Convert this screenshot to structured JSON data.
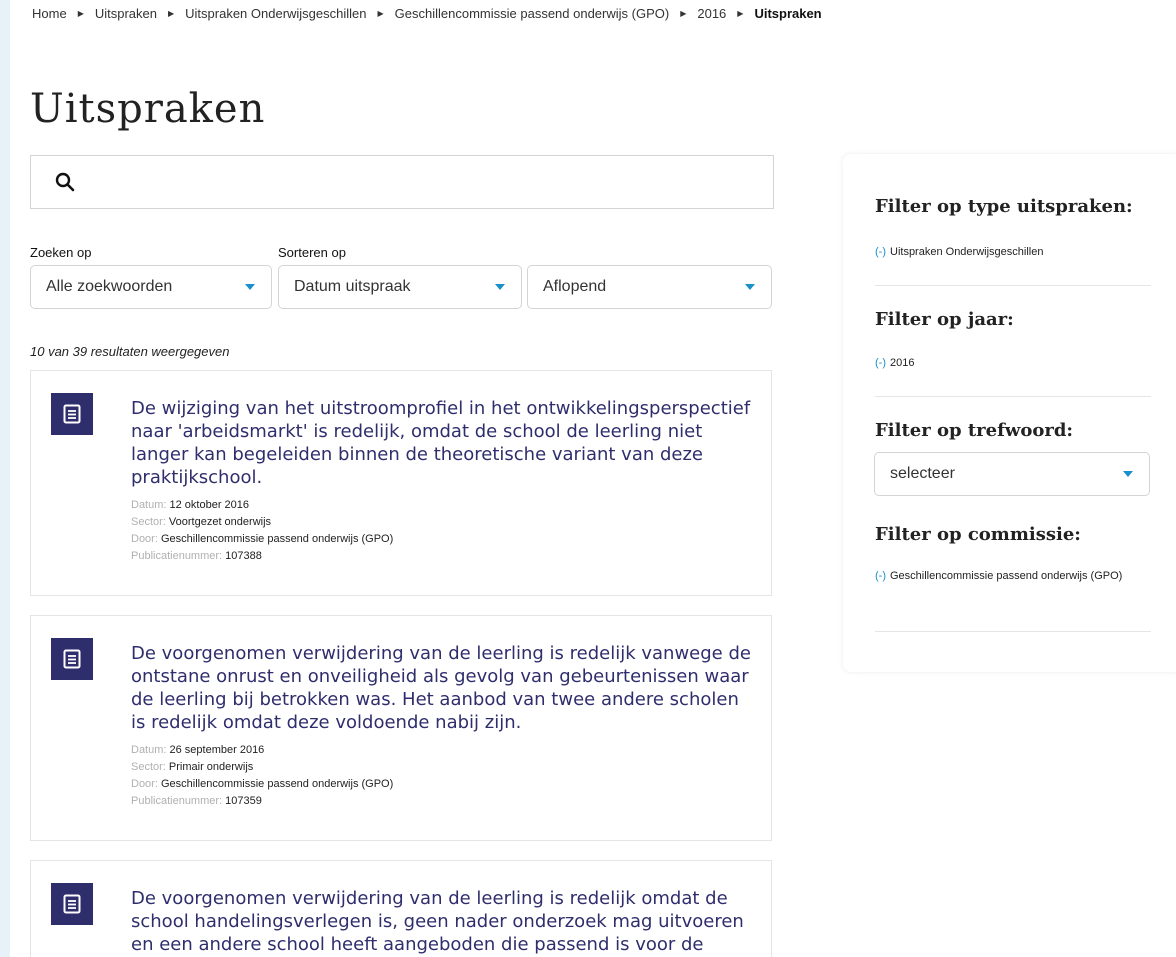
{
  "breadcrumb": [
    "Home",
    "Uitspraken",
    "Uitspraken Onderwijsgeschillen",
    "Geschillencommissie passend onderwijs (GPO)",
    "2016",
    "Uitspraken"
  ],
  "page_title": "Uitspraken",
  "search": {
    "value": "",
    "placeholder": "",
    "icon": "search-icon"
  },
  "zoeken_op": {
    "label": "Zoeken op",
    "value": "Alle zoekwoorden"
  },
  "sorteren_op": {
    "label": "Sorteren op",
    "field": "Datum uitspraak",
    "order": "Aflopend"
  },
  "results_count": "10 van 39 resultaten weergegeven",
  "meta_labels": {
    "datum": "Datum: ",
    "sector": "Sector: ",
    "door": "Door: ",
    "publicatie": "Publicatienummer: "
  },
  "results": [
    {
      "title": "De wijziging van het uitstroomprofiel in het ontwikkelingsperspectief naar 'arbeidsmarkt' is redelijk, omdat de school de leerling niet langer kan begeleiden binnen de theoretische variant van deze praktijkschool.",
      "datum": "12 oktober 2016",
      "sector": "Voortgezet onderwijs",
      "door": "Geschillencommissie passend onderwijs (GPO)",
      "publicatienummer": "107388"
    },
    {
      "title": "De voorgenomen verwijdering van de leerling is redelijk vanwege de ontstane onrust en onveiligheid als gevolg van gebeurtenissen waar de leerling bij betrokken was. Het aanbod van twee andere scholen is redelijk omdat deze voldoende nabij zijn.",
      "datum": "26 september 2016",
      "sector": "Primair onderwijs",
      "door": "Geschillencommissie passend onderwijs (GPO)",
      "publicatienummer": "107359"
    },
    {
      "title": "De voorgenomen verwijdering van de leerling is redelijk omdat de school handelingsverlegen is, geen nader onderzoek mag uitvoeren en een andere school heeft aangeboden die passend is voor de leerling."
    }
  ],
  "sidebar": {
    "type_heading": "Filter op type uitspraken:",
    "type_item": "Uitspraken Onderwijsgeschillen",
    "year_heading": "Filter op jaar:",
    "year_item": "2016",
    "keyword_heading": "Filter op trefwoord:",
    "keyword_select": "selecteer",
    "commission_heading": "Filter op commissie:",
    "commission_item": "Geschillencommissie passend onderwijs (GPO)",
    "remove_marker": "(-)"
  },
  "colors": {
    "accent": "#1a8fc9",
    "brand": "#2f2e6d"
  }
}
